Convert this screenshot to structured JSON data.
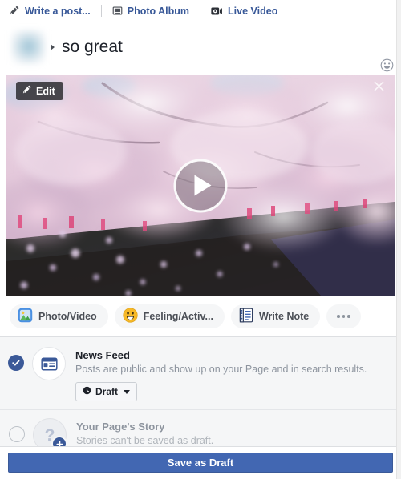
{
  "toolbar": {
    "items": [
      {
        "label": "Write a post...",
        "icon": "pencil-icon"
      },
      {
        "label": "Photo Album",
        "icon": "photo-album-icon"
      },
      {
        "label": "Live Video",
        "icon": "live-video-icon"
      }
    ]
  },
  "composer": {
    "text": "so great",
    "emoji_icon": "smiley-icon",
    "caret_visible": true
  },
  "media": {
    "edit_label": "Edit",
    "edit_icon": "pencil-icon",
    "close_icon": "close-icon",
    "play_icon": "play-icon",
    "alt": "Cherry blossom trees over a canal"
  },
  "actions": [
    {
      "label": "Photo/Video",
      "icon": "photo-video-icon",
      "name": "photo-video-button"
    },
    {
      "label": "Feeling/Activ...",
      "icon": "feeling-icon",
      "name": "feeling-activity-button"
    },
    {
      "label": "Write Note",
      "icon": "note-icon",
      "name": "write-note-button"
    },
    {
      "label": "",
      "icon": "ellipsis-icon",
      "name": "more-options-button"
    }
  ],
  "destinations": [
    {
      "title": "News Feed",
      "subtitle": "Posts are public and show up on your Page and in search results.",
      "selected": true,
      "icon": "news-feed-icon",
      "schedule": {
        "label": "Draft",
        "icon": "clock-icon",
        "chevron": "chevron-down-icon"
      }
    },
    {
      "title": "Your Page's Story",
      "subtitle": "Stories can't be saved as draft.",
      "selected": false,
      "icon": "story-avatar-icon",
      "badge": "plus-icon"
    }
  ],
  "footer": {
    "save_label": "Save as Draft"
  },
  "colors": {
    "link": "#385898",
    "accent": "#3b5998",
    "primary_button": "#4267b2",
    "panel": "#f5f6f7",
    "muted_text": "#8d949e"
  }
}
